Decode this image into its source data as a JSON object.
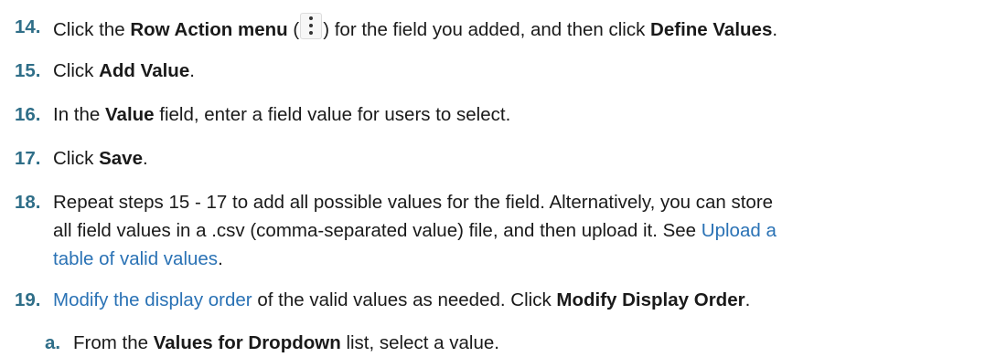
{
  "steps": [
    {
      "num": "14.",
      "t1": "Click the ",
      "b1": "Row Action menu",
      "t2": " (",
      "icon": "kebab-menu-icon",
      "t3": ") for the field you added, and then click ",
      "b2": "Define Values",
      "t4": "."
    },
    {
      "num": "15.",
      "t1": "Click ",
      "b1": "Add Value",
      "t2": "."
    },
    {
      "num": "16.",
      "t1": "In the ",
      "b1": "Value",
      "t2": " field, enter a field value for users to select."
    },
    {
      "num": "17.",
      "t1": "Click ",
      "b1": "Save",
      "t2": "."
    },
    {
      "num": "18.",
      "line1": "Repeat steps 15 - 17 to add all possible values for the field. Alternatively, you can store",
      "line2_text": "all field values in a .csv (comma-separated value) file, and then upload it. See ",
      "line2_link": "Upload a",
      "line3_link": "table of valid values",
      "line3_text": "."
    },
    {
      "num": "19.",
      "link": "Modify the display order",
      "t1": " of the valid values as needed. Click ",
      "b1": "Modify Display Order",
      "t2": "."
    }
  ],
  "substeps": [
    {
      "num": "a.",
      "t1": "From the ",
      "b1": "Values for Dropdown",
      "t2": " list, select a value."
    }
  ],
  "colors": {
    "step_number": "#2f6e88",
    "link": "#2a72b5",
    "text": "#1a1a1a"
  }
}
